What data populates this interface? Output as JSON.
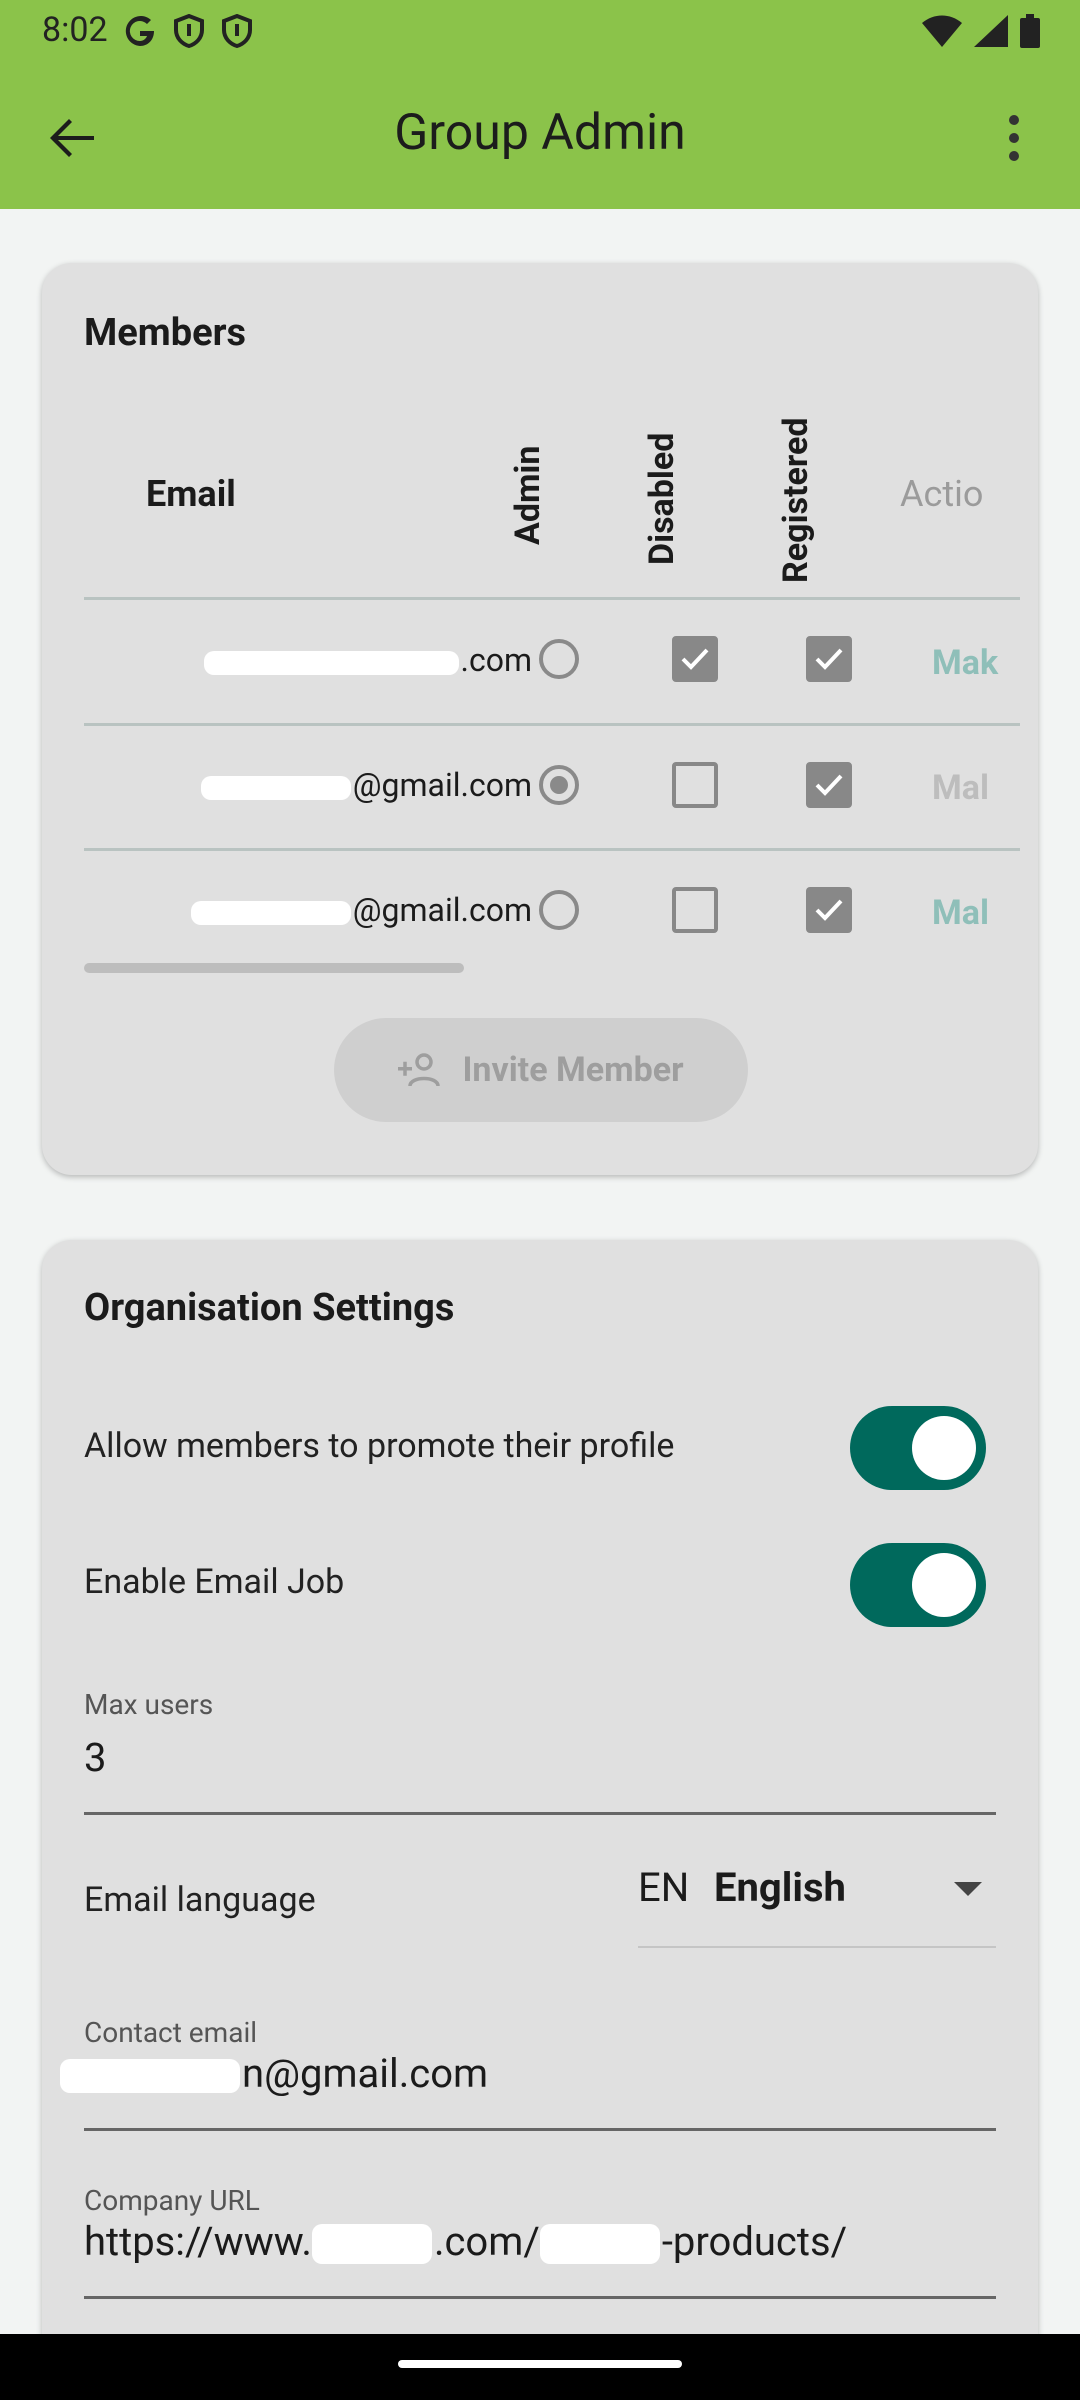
{
  "status_bar": {
    "time": "8:02",
    "left_icons": [
      "google-g-icon",
      "shield-icon",
      "shield-icon"
    ],
    "right_icons": [
      "wifi-icon",
      "signal-icon",
      "battery-icon"
    ]
  },
  "app_bar": {
    "title": "Group Admin"
  },
  "members": {
    "title": "Members",
    "headers": {
      "email": "Email",
      "admin": "Admin",
      "disabled": "Disabled",
      "registered": "Registered",
      "actions": "Actio"
    },
    "rows": [
      {
        "email_suffix": ".com",
        "admin": false,
        "disabled": true,
        "registered": true,
        "action": "Mak",
        "action_color": "#8fbfb9"
      },
      {
        "email_suffix": "@gmail.com",
        "admin": true,
        "disabled": false,
        "registered": true,
        "action": "Mal",
        "action_color": "#bdbdbd"
      },
      {
        "email_suffix": "@gmail.com",
        "admin": false,
        "disabled": false,
        "registered": true,
        "action": "Mal",
        "action_color": "#8fbfb9"
      }
    ],
    "invite_label": "Invite Member"
  },
  "settings": {
    "title": "Organisation Settings",
    "promote_label": "Allow members to promote their profile",
    "promote_on": true,
    "email_job_label": "Enable Email Job",
    "email_job_on": true,
    "max_users_label": "Max users",
    "max_users_value": "3",
    "email_language_label": "Email language",
    "language_code": "EN",
    "language_name": "English",
    "contact_email_label": "Contact email",
    "contact_email_suffix": "n@gmail.com",
    "company_url_label": "Company URL",
    "company_url_prefix": "https://www.",
    "company_url_middle": ".com/",
    "company_url_suffix": "-products/"
  },
  "colors": {
    "appbar": "#8bc34a",
    "switch_on": "#00695c"
  }
}
